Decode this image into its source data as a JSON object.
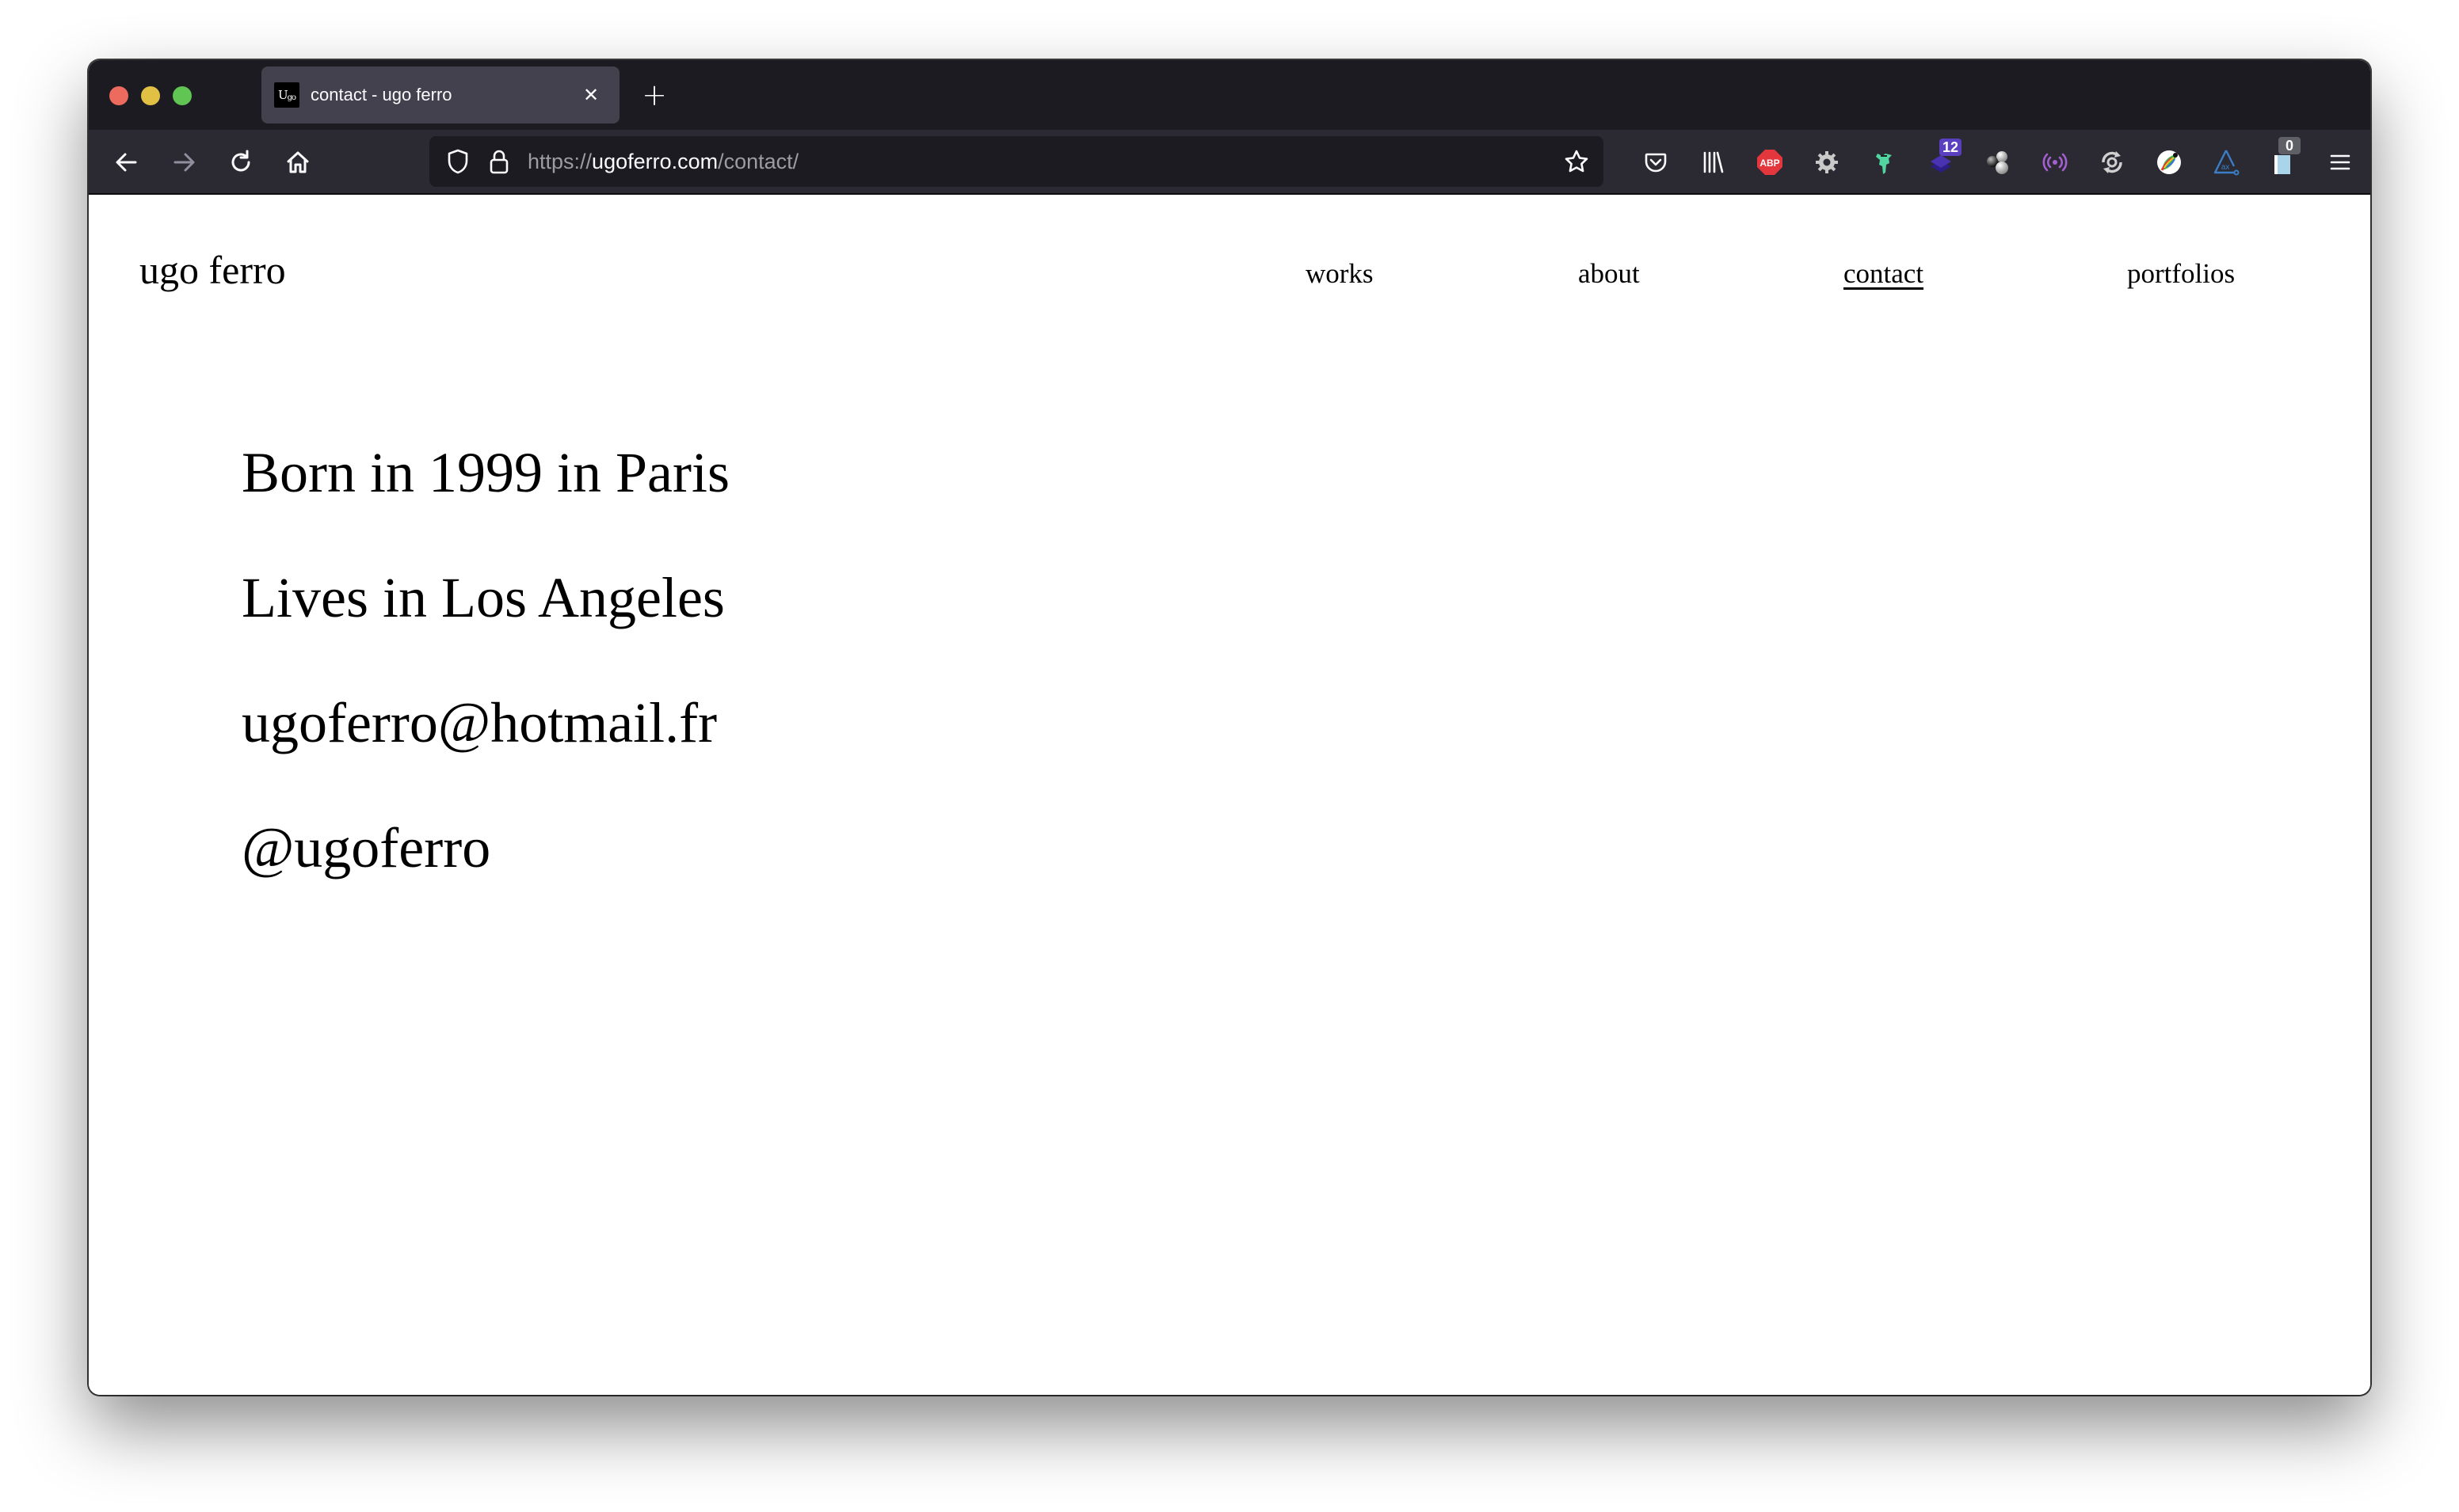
{
  "browser": {
    "window_controls": {
      "close_color": "#ed6a5e",
      "minimize_color": "#e2c044",
      "maximize_color": "#61c554"
    },
    "tabs": [
      {
        "title": "contact - ugo ferro",
        "favicon_text": "Ugo",
        "active": true,
        "close_glyph": "✕"
      }
    ],
    "new_tab_glyph": "+",
    "toolbar": {
      "back_icon": "arrow-left-icon",
      "forward_icon": "arrow-right-icon",
      "reload_icon": "reload-icon",
      "home_icon": "home-icon"
    },
    "url": {
      "scheme": "https://",
      "host": "ugoferro.com",
      "path": "/contact/"
    },
    "extensions": [
      {
        "name": "pocket-icon"
      },
      {
        "name": "library-icon"
      },
      {
        "name": "adblock-plus-icon",
        "label": "ABP",
        "color": "#e3363d"
      },
      {
        "name": "settings-gear-icon"
      },
      {
        "name": "ninja-extension-icon",
        "color": "#52d6a0"
      },
      {
        "name": "layers-extension-icon",
        "badge": "12",
        "badge_color": "#5a3fc0"
      },
      {
        "name": "molecule-extension-icon"
      },
      {
        "name": "broadcast-extension-icon",
        "color": "#a45fd0"
      },
      {
        "name": "sync-extension-icon"
      },
      {
        "name": "color-leaf-extension-icon"
      },
      {
        "name": "axe-devtools-icon",
        "label": "ax",
        "color": "#3b7ec5"
      },
      {
        "name": "clipboard-extension-icon",
        "badge": "0",
        "badge_color": "#5f5f66"
      },
      {
        "name": "hamburger-menu-icon"
      }
    ]
  },
  "site": {
    "logo": "ugo ferro",
    "nav": [
      {
        "label": "works",
        "active": false
      },
      {
        "label": "about",
        "active": false
      },
      {
        "label": "contact",
        "active": true
      },
      {
        "label": "portfolios",
        "active": false
      }
    ],
    "contact_lines": [
      "Born in 1999 in Paris",
      "Lives in Los Angeles",
      "ugoferro@hotmail.fr",
      "@ugoferro"
    ]
  }
}
